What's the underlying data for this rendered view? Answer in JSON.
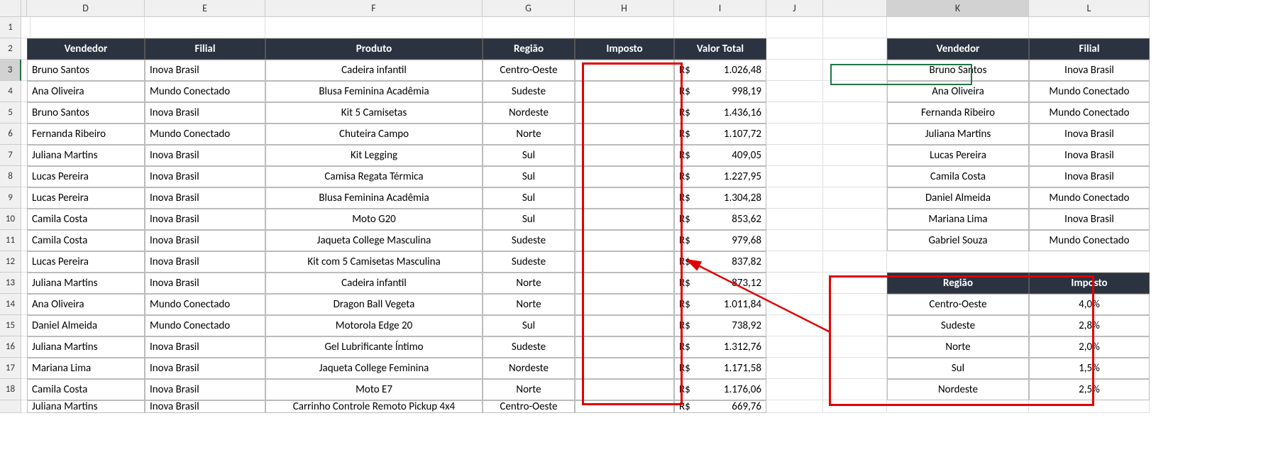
{
  "columns": [
    "",
    "",
    "D",
    "E",
    "F",
    "G",
    "H",
    "I",
    "J",
    "",
    "K",
    "L"
  ],
  "row_numbers": [
    "1",
    "2",
    "3",
    "4",
    "5",
    "6",
    "7",
    "8",
    "9",
    "10",
    "11",
    "12",
    "13",
    "14",
    "15",
    "16",
    "17",
    "18",
    ""
  ],
  "main": {
    "headers": [
      "Vendedor",
      "Filial",
      "Produto",
      "Região",
      "Imposto",
      "Valor Total"
    ],
    "rows": [
      {
        "vendedor": "Bruno Santos",
        "filial": "Inova Brasil",
        "produto": "Cadeira infantil",
        "regiao": "Centro-Oeste",
        "imposto": "",
        "valor": "1.026,48"
      },
      {
        "vendedor": "Ana Oliveira",
        "filial": "Mundo Conectado",
        "produto": "Blusa Feminina Acadêmia",
        "regiao": "Sudeste",
        "imposto": "",
        "valor": "998,19"
      },
      {
        "vendedor": "Bruno Santos",
        "filial": "Inova Brasil",
        "produto": "Kit 5 Camisetas",
        "regiao": "Nordeste",
        "imposto": "",
        "valor": "1.436,16"
      },
      {
        "vendedor": "Fernanda Ribeiro",
        "filial": "Mundo Conectado",
        "produto": "Chuteira Campo",
        "regiao": "Norte",
        "imposto": "",
        "valor": "1.107,72"
      },
      {
        "vendedor": "Juliana Martins",
        "filial": "Inova Brasil",
        "produto": "Kit Legging",
        "regiao": "Sul",
        "imposto": "",
        "valor": "409,05"
      },
      {
        "vendedor": "Lucas Pereira",
        "filial": "Inova Brasil",
        "produto": "Camisa Regata Térmica",
        "regiao": "Sul",
        "imposto": "",
        "valor": "1.227,95"
      },
      {
        "vendedor": "Lucas Pereira",
        "filial": "Inova Brasil",
        "produto": "Blusa Feminina Acadêmia",
        "regiao": "Sul",
        "imposto": "",
        "valor": "1.304,28"
      },
      {
        "vendedor": "Camila Costa",
        "filial": "Inova Brasil",
        "produto": "Moto G20",
        "regiao": "Sul",
        "imposto": "",
        "valor": "853,62"
      },
      {
        "vendedor": "Camila Costa",
        "filial": "Inova Brasil",
        "produto": "Jaqueta College Masculina",
        "regiao": "Sudeste",
        "imposto": "",
        "valor": "979,68"
      },
      {
        "vendedor": "Lucas Pereira",
        "filial": "Inova Brasil",
        "produto": "Kit com 5 Camisetas Masculina",
        "regiao": "Sudeste",
        "imposto": "",
        "valor": "837,82"
      },
      {
        "vendedor": "Juliana Martins",
        "filial": "Inova Brasil",
        "produto": "Cadeira infantil",
        "regiao": "Norte",
        "imposto": "",
        "valor": "873,12"
      },
      {
        "vendedor": "Ana Oliveira",
        "filial": "Mundo Conectado",
        "produto": "Dragon Ball Vegeta",
        "regiao": "Norte",
        "imposto": "",
        "valor": "1.011,84"
      },
      {
        "vendedor": "Daniel Almeida",
        "filial": "Mundo Conectado",
        "produto": "Motorola Edge 20",
        "regiao": "Sul",
        "imposto": "",
        "valor": "738,92"
      },
      {
        "vendedor": "Juliana Martins",
        "filial": "Inova Brasil",
        "produto": "Gel Lubrificante Íntimo",
        "regiao": "Sudeste",
        "imposto": "",
        "valor": "1.312,76"
      },
      {
        "vendedor": "Mariana Lima",
        "filial": "Inova Brasil",
        "produto": "Jaqueta College Feminina",
        "regiao": "Nordeste",
        "imposto": "",
        "valor": "1.171,58"
      },
      {
        "vendedor": "Camila Costa",
        "filial": "Inova Brasil",
        "produto": "Moto E7",
        "regiao": "Norte",
        "imposto": "",
        "valor": "1.176,06"
      },
      {
        "vendedor": "Juliana Martins",
        "filial": "Inova Brasil",
        "produto": "Carrinho Controle Remoto Pickup 4x4",
        "regiao": "Centro-Oeste",
        "imposto": "",
        "valor": "669,76"
      }
    ],
    "currency": "R$"
  },
  "side1": {
    "headers": [
      "Vendedor",
      "Filial"
    ],
    "rows": [
      {
        "vendedor": "Bruno Santos",
        "filial": "Inova Brasil"
      },
      {
        "vendedor": "Ana Oliveira",
        "filial": "Mundo Conectado"
      },
      {
        "vendedor": "Fernanda Ribeiro",
        "filial": "Mundo Conectado"
      },
      {
        "vendedor": "Juliana Martins",
        "filial": "Inova Brasil"
      },
      {
        "vendedor": "Lucas Pereira",
        "filial": "Inova Brasil"
      },
      {
        "vendedor": "Camila Costa",
        "filial": "Inova Brasil"
      },
      {
        "vendedor": "Daniel Almeida",
        "filial": "Mundo Conectado"
      },
      {
        "vendedor": "Mariana Lima",
        "filial": "Inova Brasil"
      },
      {
        "vendedor": "Gabriel Souza",
        "filial": "Mundo Conectado"
      }
    ]
  },
  "side2": {
    "headers": [
      "Região",
      "Imposto"
    ],
    "rows": [
      {
        "regiao": "Centro-Oeste",
        "imposto": "4,0%"
      },
      {
        "regiao": "Sudeste",
        "imposto": "2,8%"
      },
      {
        "regiao": "Norte",
        "imposto": "2,0%"
      },
      {
        "regiao": "Sul",
        "imposto": "1,5%"
      },
      {
        "regiao": "Nordeste",
        "imposto": "2,5%"
      }
    ]
  },
  "active_cell": "K3"
}
